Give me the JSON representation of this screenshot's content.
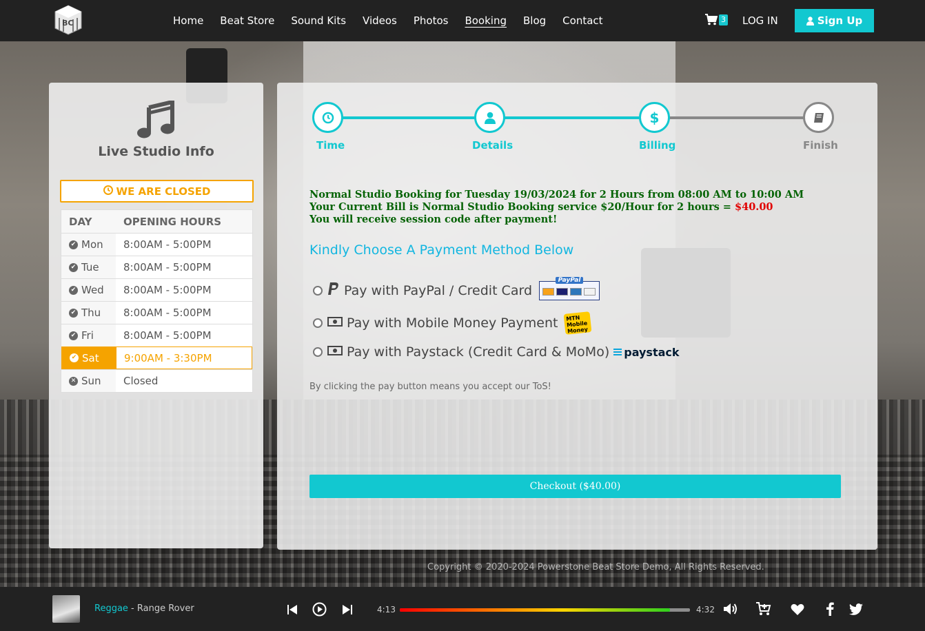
{
  "header": {
    "logo_text": "BC",
    "nav": [
      "Home",
      "Beat Store",
      "Sound Kits",
      "Videos",
      "Photos",
      "Booking",
      "Blog",
      "Contact"
    ],
    "active_nav": "Booking",
    "cart_count": "3",
    "login_label": "LOG IN",
    "signup_label": "Sign Up"
  },
  "studio": {
    "title": "Live Studio Info",
    "status": "WE ARE CLOSED",
    "hours_header": {
      "day": "DAY",
      "hours": "OPENING HOURS"
    },
    "hours": [
      {
        "day": "Mon",
        "hours": "8:00AM - 5:00PM",
        "status": "open"
      },
      {
        "day": "Tue",
        "hours": "8:00AM - 5:00PM",
        "status": "open"
      },
      {
        "day": "Wed",
        "hours": "8:00AM - 5:00PM",
        "status": "open"
      },
      {
        "day": "Thu",
        "hours": "8:00AM - 5:00PM",
        "status": "open"
      },
      {
        "day": "Fri",
        "hours": "8:00AM - 5:00PM",
        "status": "open"
      },
      {
        "day": "Sat",
        "hours": "9:00AM - 3:30PM",
        "status": "today"
      },
      {
        "day": "Sun",
        "hours": "Closed",
        "status": "closed"
      }
    ]
  },
  "steps": [
    {
      "label": "Time",
      "state": "done",
      "icon": "clock-icon"
    },
    {
      "label": "Details",
      "state": "done",
      "icon": "user-icon"
    },
    {
      "label": "Billing",
      "state": "active",
      "icon": "dollar-icon"
    },
    {
      "label": "Finish",
      "state": "pending",
      "icon": "book-icon"
    }
  ],
  "booking": {
    "line1": "Normal Studio Booking for Tuesday 19/03/2024 for 2 Hours from 08:00 AM to 10:00 AM",
    "line2_prefix": "Your Current Bill is Normal Studio Booking service $20/Hour for 2 hours = ",
    "line2_price": "$40.00",
    "line3": "You will receive session code after payment!",
    "choose_label": "Kindly Choose A Payment Method Below",
    "payment_methods": [
      {
        "label": "Pay with PayPal / Credit Card",
        "logo": "paypal-logo",
        "logo_text": "PayPal"
      },
      {
        "label": "Pay with Mobile Money Payment",
        "logo": "mtn-mobile-money-logo",
        "logo_text": "MTN Mobile Money"
      },
      {
        "label": "Pay with Paystack (Credit Card & MoMo)",
        "logo": "paystack-logo",
        "logo_text": "paystack"
      }
    ],
    "tos": "By clicking the pay button means you accept our ToS!",
    "checkout_label": "Checkout ($40.00)"
  },
  "footer": {
    "copyright": "Copyright © 2020-2024 Powerstone Beat Store Demo, All Rights Reserved."
  },
  "player": {
    "genre": "Reggae",
    "separator": " - ",
    "title": "Range Rover",
    "current_time": "4:13",
    "total_time": "4:32",
    "progress": 0.93
  },
  "colors": {
    "accent": "#12c8d0",
    "warning": "#f5a300",
    "success_text": "#056305",
    "price": "#e10000"
  }
}
